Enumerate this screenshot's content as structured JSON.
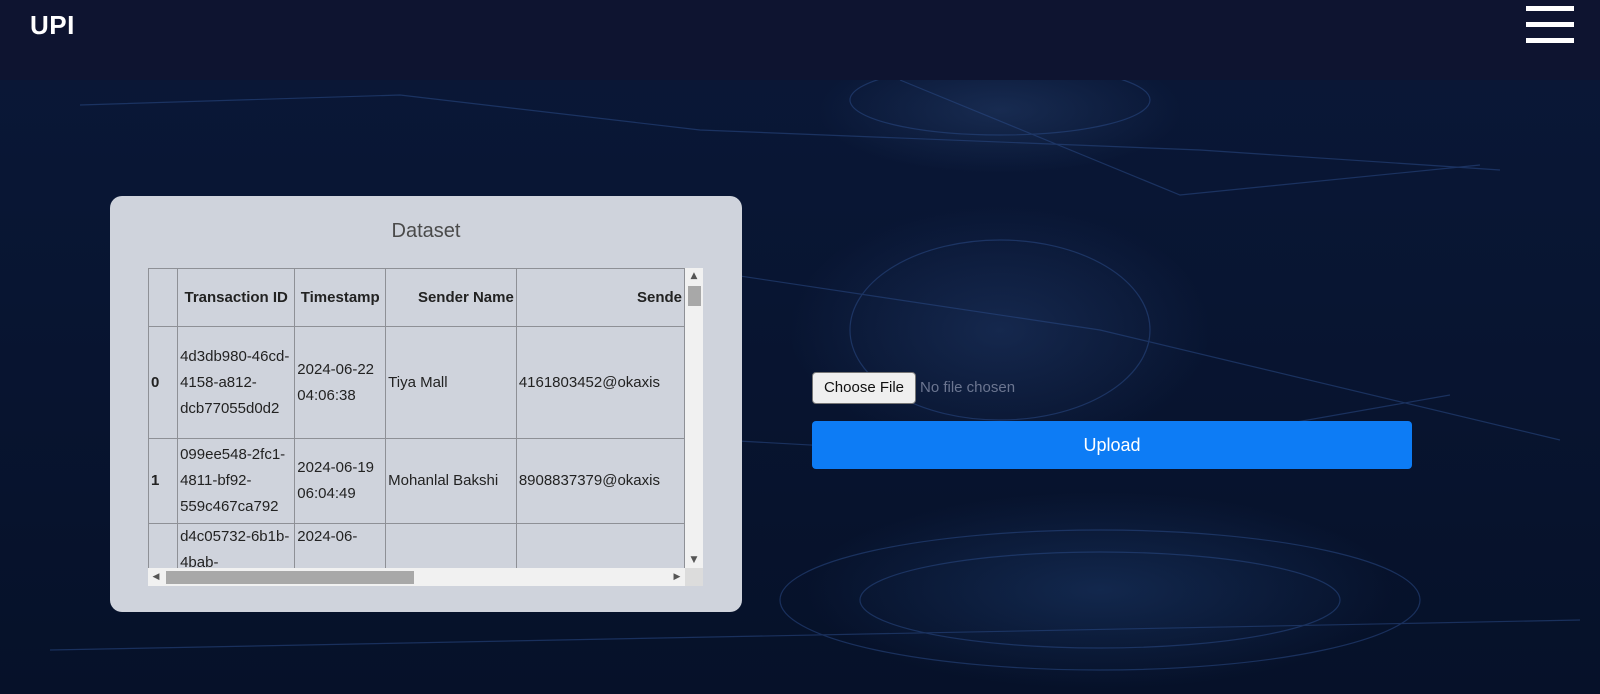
{
  "header": {
    "brand": "UPI",
    "menu_icon": "hamburger-menu-icon"
  },
  "dataset": {
    "title": "Dataset",
    "columns": [
      "",
      "Transaction ID",
      "Timestamp",
      "Sender Name",
      "Sende"
    ],
    "rows": [
      {
        "index": "0",
        "transaction_id": "4d3db980-46cd-4158-a812-dcb77055d0d2",
        "timestamp": "2024-06-22 04:06:38",
        "sender_name": "Tiya Mall",
        "sender_upi": "4161803452@okaxis"
      },
      {
        "index": "1",
        "transaction_id": "099ee548-2fc1-4811-bf92-559c467ca792",
        "timestamp": "2024-06-19 06:04:49",
        "sender_name": "Mohanlal Bakshi",
        "sender_upi": "8908837379@okaxis"
      },
      {
        "index": "",
        "transaction_id": "d4c05732-6b1b-4bab-",
        "timestamp": "2024-06-",
        "sender_name": "",
        "sender_upi": ""
      }
    ]
  },
  "upload": {
    "choose_label": "Choose File",
    "file_status": "No file chosen",
    "upload_label": "Upload"
  },
  "colors": {
    "header_bg": "#0e1430",
    "page_bg": "#071431",
    "card_bg": "#cfd3dc",
    "upload_button": "#0d7cf5"
  }
}
